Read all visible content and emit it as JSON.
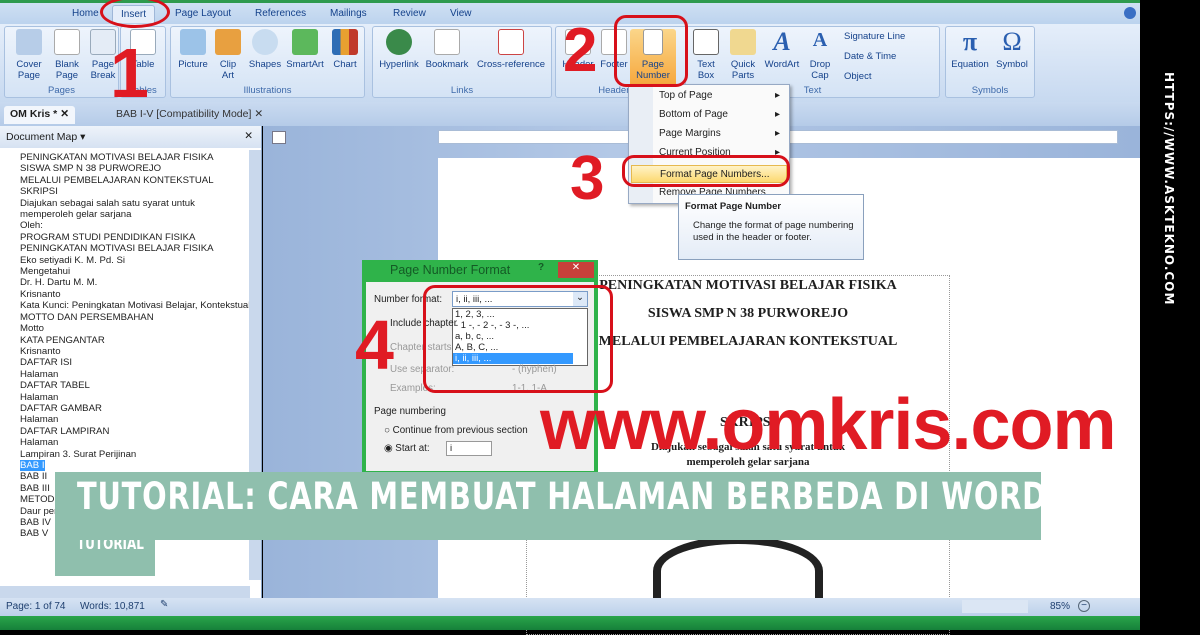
{
  "ribbon": {
    "tabs": [
      "Home",
      "Insert",
      "Page Layout",
      "References",
      "Mailings",
      "Review",
      "View"
    ],
    "groups": {
      "pages": "Pages",
      "tables": "Tables",
      "illustrations": "Illustrations",
      "links": "Links",
      "header_footer": "Header & F",
      "text": "Text",
      "symbols": "Symbols"
    },
    "buttons": {
      "cover_page": "Cover Page",
      "blank_page": "Blank Page",
      "page_break": "Page Break",
      "table": "Table",
      "picture": "Picture",
      "clip_art": "Clip Art",
      "shapes": "Shapes",
      "smartart": "SmartArt",
      "chart": "Chart",
      "hyperlink": "Hyperlink",
      "bookmark": "Bookmark",
      "cross_reference": "Cross-reference",
      "header": "Header",
      "footer": "Footer",
      "page_number": "Page Number",
      "text_box": "Text Box",
      "quick_parts": "Quick Parts",
      "wordart": "WordArt",
      "drop_cap": "Drop Cap",
      "signature_line": "Signature Line",
      "date_time": "Date & Time",
      "object": "Object",
      "equation": "Equation",
      "symbol": "Symbol"
    }
  },
  "doc_tabs": [
    "OM Kris *",
    "BAB I-V [Compatibility Mode]"
  ],
  "document_map": {
    "title": "Document Map",
    "items": [
      "PENINGKATAN MOTIVASI BELAJAR FISIKA",
      "SISWA SMP N 38 PURWOREJO",
      "MELALUI  PEMBELAJARAN KONTEKSTUAL",
      "SKRIPSI",
      "Diajukan sebagai salah satu syarat untuk",
      "memperoleh gelar sarjana",
      "Oleh:",
      "PROGRAM STUDI PENDIDIKAN FISIKA",
      "PENINGKATAN MOTIVASI BELAJAR FISIKA",
      "Eko setiyadi K. M. Pd. Si",
      "Mengetahui",
      "Dr. H. Dartu M. M.",
      "Krisnanto",
      "Kata Kunci: Peningkatan Motivasi Belajar, Kontekstual",
      "MOTTO DAN PERSEMBAHAN",
      "Motto",
      "KATA PENGANTAR",
      "Krisnanto",
      "DAFTAR ISI",
      "Halaman",
      "DAFTAR TABEL",
      "Halaman",
      "DAFTAR GAMBAR",
      "Halaman",
      "DAFTAR LAMPIRAN",
      "Halaman",
      "Lampiran 3.  Surat Perijinan",
      "BAB I",
      "BAB II",
      "BAB III",
      "METODE",
      "Daur per",
      "BAB IV",
      "BAB V"
    ],
    "selected": "BAB I"
  },
  "page_number_menu": {
    "items": [
      "Top of Page",
      "Bottom of Page",
      "Page Margins",
      "Current Position",
      "Format Page Numbers...",
      "Remove Page Numbers"
    ]
  },
  "tooltip": {
    "title": "Format Page Number",
    "body": "Change the format of page numbering used in the header or footer."
  },
  "dialog": {
    "title": "Page Number Format",
    "help": "?",
    "number_format_label": "Number format:",
    "number_format_value": "i, ii, iii, ...",
    "options": [
      "1, 2, 3, ...",
      "- 1 -, - 2 -, - 3 -, ...",
      "a, b, c, ...",
      "A, B, C, ...",
      "i, ii, iii, ..."
    ],
    "include_chapter": "Include chapter",
    "chapter_starts": "Chapter starts",
    "use_separator": "Use separator:",
    "separator_value": "- (hyphen)",
    "examples": "Examples:",
    "examples_value": "1-1, 1-A",
    "page_numbering": "Page numbering",
    "continue": "Continue from previous section",
    "start_at": "Start at:",
    "start_at_value": "i"
  },
  "page": {
    "lines": [
      "PENINGKATAN MOTIVASI BELAJAR FISIKA",
      "SISWA SMP N 38 PURWOREJO",
      "MELALUI  PEMBELAJARAN KONTEKSTUAL",
      "SKRIPSI",
      "Diajukan sebagai salah satu syarat untuk",
      "memperoleh gelar sarjana"
    ]
  },
  "status": {
    "page": "Page: 1 of 74",
    "words": "Words: 10,871",
    "zoom": "85%"
  },
  "annotations": {
    "steps": [
      "1",
      "2",
      "3",
      "4"
    ],
    "watermark": "www.omkris.com"
  },
  "banner": {
    "title": "TUTORIAL: CARA MEMBUAT HALAMAN BERBEDA DI WORD",
    "tag": "TUTORIAL"
  },
  "side_url": "HTTPS://WWW.ASKTEKNO.COM",
  "colors": {
    "accent_red": "#e01b24",
    "banner": "#8fbfad",
    "dialog_green": "#2fb34a"
  }
}
